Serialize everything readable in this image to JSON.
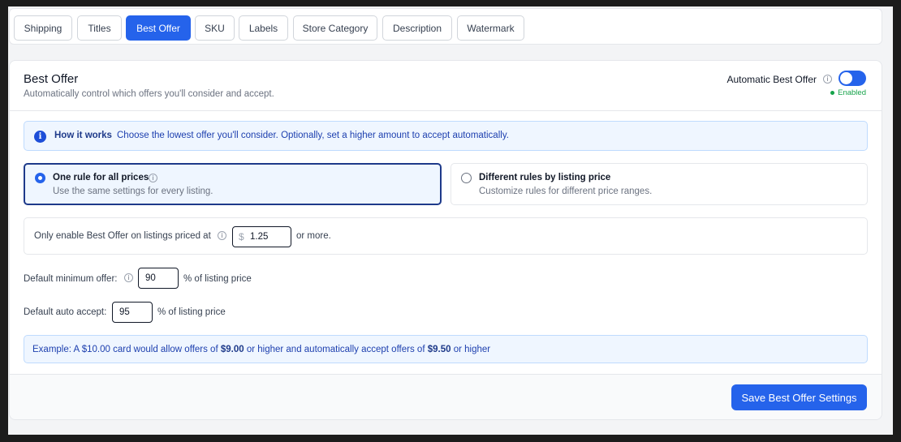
{
  "tabs": [
    {
      "label": "Shipping",
      "active": false
    },
    {
      "label": "Titles",
      "active": false
    },
    {
      "label": "Best Offer",
      "active": true
    },
    {
      "label": "SKU",
      "active": false
    },
    {
      "label": "Labels",
      "active": false
    },
    {
      "label": "Store Category",
      "active": false
    },
    {
      "label": "Description",
      "active": false
    },
    {
      "label": "Watermark",
      "active": false
    }
  ],
  "card": {
    "title": "Best Offer",
    "subtitle": "Automatically control which offers you'll consider and accept.",
    "auto_label": "Automatic Best Offer",
    "auto_enabled": true,
    "status": "Enabled"
  },
  "how_it_works": {
    "title": "How it works",
    "text": "Choose the lowest offer you'll consider. Optionally, set a higher amount to accept automatically."
  },
  "options": [
    {
      "title": "One rule for all prices",
      "description": "Use the same settings for every listing.",
      "selected": true
    },
    {
      "title": "Different rules by listing price",
      "description": "Customize rules for different price ranges.",
      "selected": false
    }
  ],
  "price_threshold": {
    "label": "Only enable Best Offer on listings priced at",
    "currency": "$",
    "value": "1.25",
    "suffix": "or more."
  },
  "min_offer": {
    "label": "Default minimum offer:",
    "value": "90",
    "suffix": "% of listing price"
  },
  "auto_accept": {
    "label": "Default auto accept:",
    "value": "95",
    "suffix": "% of listing price"
  },
  "example": {
    "p1": "Example: A $10.00 card would allow offers of ",
    "v1": "$9.00",
    "p2": " or higher and automatically accept offers of ",
    "v2": "$9.50",
    "p3": " or higher"
  },
  "save_label": "Save Best Offer Settings",
  "colors": {
    "accent": "#2563eb",
    "success": "#16a34a",
    "info_bg": "#eff6ff"
  }
}
